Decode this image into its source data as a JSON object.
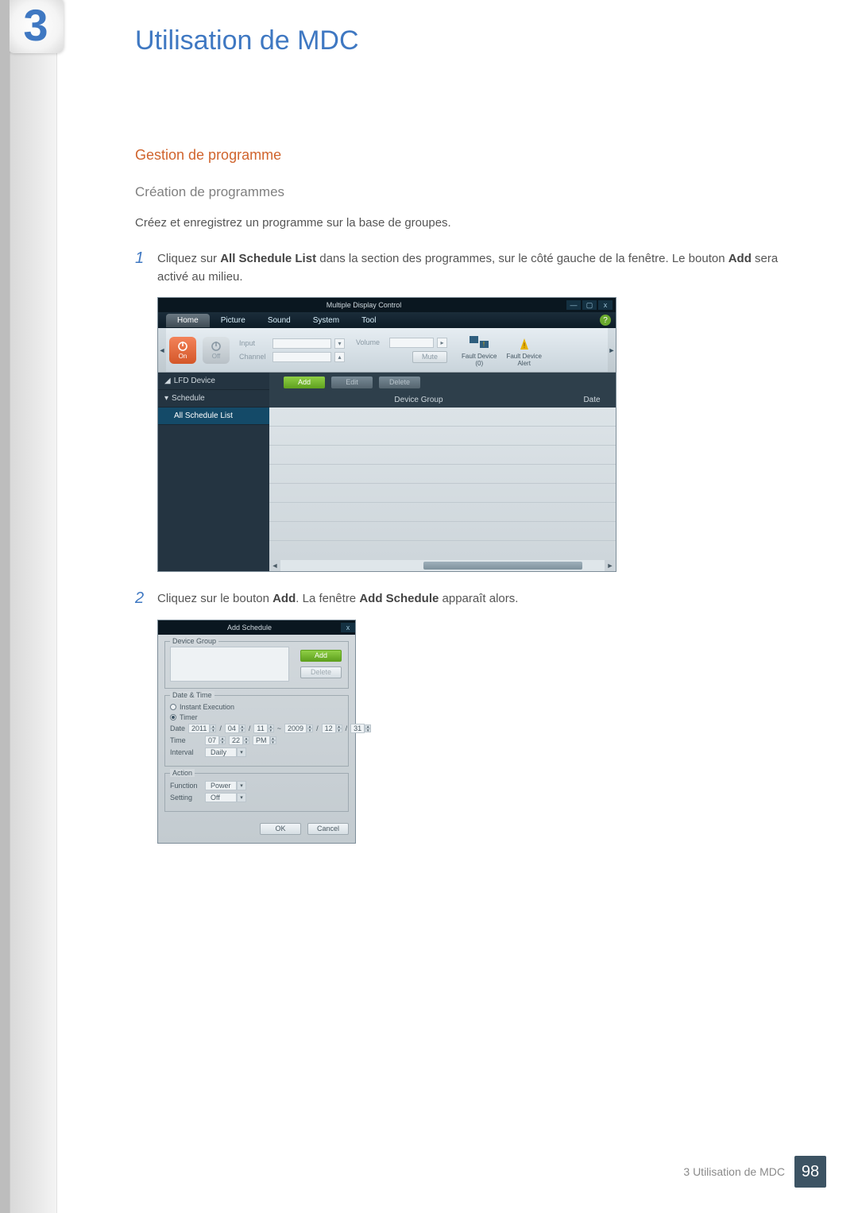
{
  "chapter_number": "3",
  "chapter_title": "Utilisation de MDC",
  "section_title": "Gestion de programme",
  "subsection_title": "Création de programmes",
  "intro_text": "Créez et enregistrez un programme sur la base de groupes.",
  "step1_num": "1",
  "step1_a": "Cliquez sur ",
  "step1_b": "All Schedule List",
  "step1_c": " dans la section des programmes, sur le côté gauche de la fenêtre. Le bouton ",
  "step1_d": "Add",
  "step1_e": " sera activé au milieu.",
  "step2_num": "2",
  "step2_a": "Cliquez sur le bouton ",
  "step2_b": "Add",
  "step2_c": ". La fenêtre ",
  "step2_d": "Add Schedule",
  "step2_e": " apparaît alors.",
  "mdc": {
    "title": "Multiple Display Control",
    "win_min": "—",
    "win_max": "▢",
    "win_close": "x",
    "menu_home": "Home",
    "menu_picture": "Picture",
    "menu_sound": "Sound",
    "menu_system": "System",
    "menu_tool": "Tool",
    "help": "?",
    "on_label": "On",
    "off_label": "Off",
    "input_label": "Input",
    "channel_label": "Channel",
    "volume_label": "Volume",
    "mute_label": "Mute",
    "fault1_line1": "Fault Device",
    "fault1_line2": "(0)",
    "fault2_line1": "Fault Device",
    "fault2_line2": "Alert",
    "tree_lfd": "LFD Device",
    "tree_schedule": "Schedule",
    "tree_all": "All Schedule List",
    "btn_add": "Add",
    "btn_edit": "Edit",
    "btn_delete": "Delete",
    "col_group": "Device Group",
    "col_date": "Date"
  },
  "dlg": {
    "title": "Add Schedule",
    "close": "x",
    "devgroup": "Device Group",
    "add": "Add",
    "delete": "Delete",
    "datetime": "Date & Time",
    "instant": "Instant Execution",
    "timer": "Timer",
    "date_label": "Date",
    "time_label": "Time",
    "interval_label": "Interval",
    "d_y1": "2011",
    "d_m1": "04",
    "d_d1": "11",
    "d_sep": " ~ ",
    "d_y2": "2009",
    "d_m2": "12",
    "d_d2": "31",
    "t_h": "07",
    "t_m": "22",
    "t_ap": "PM",
    "interval_val": "Daily",
    "action": "Action",
    "function_label": "Function",
    "function_val": "Power",
    "setting_label": "Setting",
    "setting_val": "Off",
    "ok": "OK",
    "cancel": "Cancel"
  },
  "footer_text": "3 Utilisation de MDC",
  "page_number": "98"
}
